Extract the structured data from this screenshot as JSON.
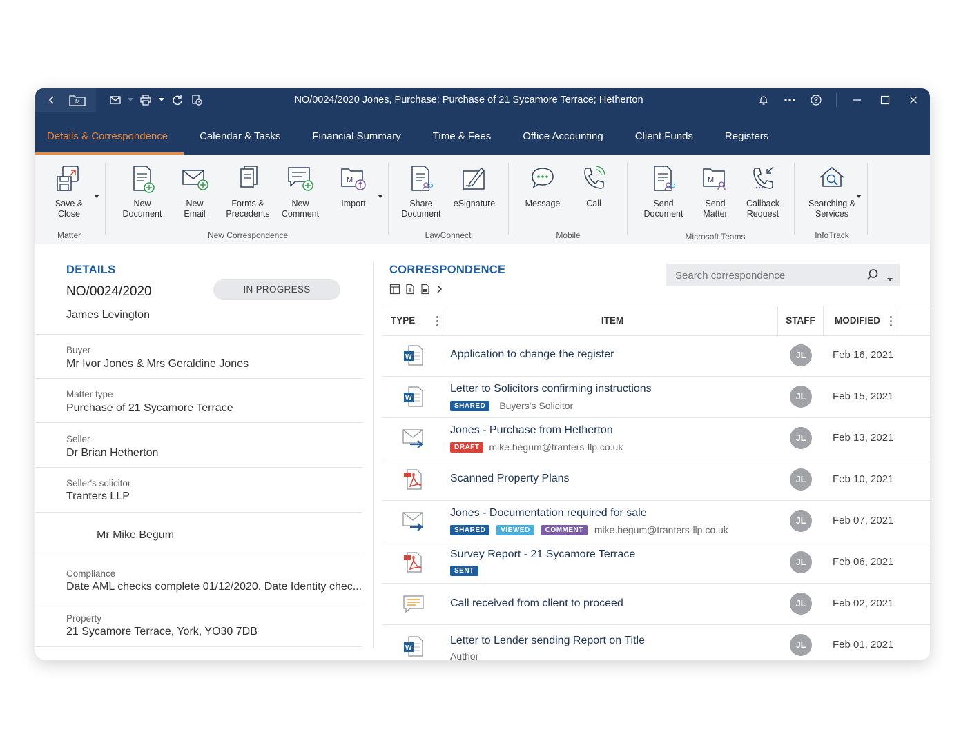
{
  "window": {
    "title": "NO/0024/2020 Jones, Purchase; Purchase of 21 Sycamore Terrace; Hetherton"
  },
  "tabs": [
    {
      "label": "Details & Correspondence",
      "active": true
    },
    {
      "label": "Calendar & Tasks"
    },
    {
      "label": "Financial Summary"
    },
    {
      "label": "Time & Fees"
    },
    {
      "label": "Office Accounting"
    },
    {
      "label": "Client Funds"
    },
    {
      "label": "Registers"
    }
  ],
  "ribbon": {
    "buttons": [
      {
        "l1": "Save &",
        "l2": "Close",
        "icon": "save-close-icon"
      },
      {
        "l1": "New",
        "l2": "Document",
        "icon": "new-document-icon"
      },
      {
        "l1": "New",
        "l2": "Email",
        "icon": "new-email-icon"
      },
      {
        "l1": "Forms &",
        "l2": "Precedents",
        "icon": "forms-icon"
      },
      {
        "l1": "New",
        "l2": "Comment",
        "icon": "new-comment-icon"
      },
      {
        "l1": "Import",
        "l2": "",
        "icon": "import-icon"
      },
      {
        "l1": "Share",
        "l2": "Document",
        "icon": "share-document-icon"
      },
      {
        "l1": "eSignature",
        "l2": "",
        "icon": "esignature-icon"
      },
      {
        "l1": "Message",
        "l2": "",
        "icon": "message-icon"
      },
      {
        "l1": "Call",
        "l2": "",
        "icon": "call-icon"
      },
      {
        "l1": "Send",
        "l2": "Document",
        "icon": "send-document-icon"
      },
      {
        "l1": "Send",
        "l2": "Matter",
        "icon": "send-matter-icon"
      },
      {
        "l1": "Callback",
        "l2": "Request",
        "icon": "callback-icon"
      },
      {
        "l1": "Searching &",
        "l2": "Services",
        "icon": "searching-icon"
      }
    ],
    "groups": {
      "matter": "Matter",
      "new_correspondence": "New Correspondence",
      "lawconnect": "LawConnect",
      "mobile": "Mobile",
      "teams": "Microsoft Teams",
      "infotrack": "InfoTrack"
    }
  },
  "details": {
    "heading": "DETAILS",
    "matter_number": "NO/0024/2020",
    "status": "IN PROGRESS",
    "client": "James Levington",
    "fields": [
      {
        "label": "Buyer",
        "value": "Mr Ivor Jones & Mrs Geraldine Jones"
      },
      {
        "label": "Matter type",
        "value": "Purchase of 21 Sycamore Terrace"
      },
      {
        "label": "Seller",
        "value": "Dr Brian Hetherton"
      },
      {
        "label": "Seller's solicitor",
        "value": "Tranters LLP"
      },
      {
        "label": "",
        "value": "Mr Mike Begum"
      },
      {
        "label": "Compliance",
        "value": "Date AML checks complete 01/12/2020. Date Identity chec..."
      },
      {
        "label": "Property",
        "value": "21 Sycamore Terrace, York, YO30 7DB"
      }
    ]
  },
  "correspondence": {
    "heading": "CORRESPONDENCE",
    "search_placeholder": "Search correspondence",
    "columns": {
      "type": "TYPE",
      "item": "ITEM",
      "staff": "STAFF",
      "modified": "MODIFIED"
    },
    "rows": [
      {
        "type": "word",
        "title": "Application to change the register",
        "badges": [],
        "sub": "",
        "staff": "JL",
        "modified": "Feb 16, 2021"
      },
      {
        "type": "word",
        "title": "Letter to Solicitors confirming instructions",
        "badges": [
          "SHARED"
        ],
        "sub": "Buyers's Solicitor",
        "staff": "JL",
        "modified": "Feb 15, 2021"
      },
      {
        "type": "email",
        "title": "Jones - Purchase from Hetherton",
        "badges": [
          "DRAFT"
        ],
        "sub": "mike.begum@tranters-llp.co.uk",
        "staff": "JL",
        "modified": "Feb 13, 2021"
      },
      {
        "type": "pdf",
        "title": "Scanned Property Plans",
        "badges": [],
        "sub": "",
        "staff": "JL",
        "modified": "Feb 10, 2021"
      },
      {
        "type": "email",
        "title": "Jones - Documentation required for sale",
        "badges": [
          "SHARED",
          "VIEWED",
          "COMMENT"
        ],
        "sub": "mike.begum@tranters-llp.co.uk",
        "staff": "JL",
        "modified": "Feb 07, 2021"
      },
      {
        "type": "pdf",
        "title": "Survey Report - 21 Sycamore Terrace",
        "badges": [
          "SENT"
        ],
        "sub": "",
        "staff": "JL",
        "modified": "Feb 06, 2021"
      },
      {
        "type": "note",
        "title": "Call received from client to proceed",
        "badges": [],
        "sub": "",
        "staff": "JL",
        "modified": "Feb 02, 2021"
      },
      {
        "type": "word",
        "title": "Letter to Lender sending Report on Title",
        "badges": [],
        "sub": "Author",
        "staff": "JL",
        "modified": "Feb 01, 2021"
      }
    ]
  },
  "colors": {
    "navy": "#1f3a63",
    "accent": "#f0883a",
    "heading": "#1f5f9e"
  }
}
